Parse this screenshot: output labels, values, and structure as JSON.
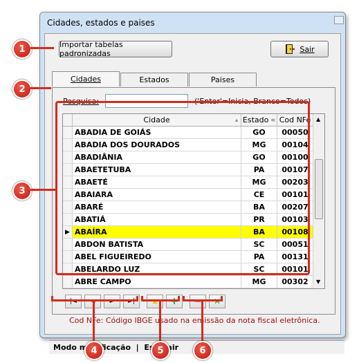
{
  "window": {
    "title": "Cidades, estados e paises"
  },
  "toolbar": {
    "import_label": "Importar tabelas padronizadas",
    "exit_label": "Sair"
  },
  "tabs": [
    {
      "label": "Cidades"
    },
    {
      "label": "Estados"
    },
    {
      "label": "Paises"
    }
  ],
  "search": {
    "label": "Pesquisa:",
    "value": "",
    "hint": "('Enter'=Inicia, Branco=Todos)"
  },
  "grid": {
    "columns": [
      "Cidade",
      "Estado",
      "Cod NFe"
    ],
    "rows": [
      {
        "cidade": "ABADIA DE GOIÁS",
        "estado": "GO",
        "cod": "00050"
      },
      {
        "cidade": "ABADIA DOS DOURADOS",
        "estado": "MG",
        "cod": "00104"
      },
      {
        "cidade": "ABADIÂNIA",
        "estado": "GO",
        "cod": "00100"
      },
      {
        "cidade": "ABAETETUBA",
        "estado": "PA",
        "cod": "00107"
      },
      {
        "cidade": "ABAETÉ",
        "estado": "MG",
        "cod": "00203"
      },
      {
        "cidade": "ABAIARA",
        "estado": "CE",
        "cod": "00101"
      },
      {
        "cidade": "ABARÉ",
        "estado": "BA",
        "cod": "00207"
      },
      {
        "cidade": "ABATIÁ",
        "estado": "PR",
        "cod": "00103"
      },
      {
        "cidade": "ABAÍRA",
        "estado": "BA",
        "cod": "00108"
      },
      {
        "cidade": "ABDON BATISTA",
        "estado": "SC",
        "cod": "00051"
      },
      {
        "cidade": "ABEL FIGUEIREDO",
        "estado": "PA",
        "cod": "00131"
      },
      {
        "cidade": "ABELARDO LUZ",
        "estado": "SC",
        "cod": "00101"
      },
      {
        "cidade": "ABRE CAMPO",
        "estado": "MG",
        "cod": "00302"
      }
    ],
    "selected_index": 8
  },
  "nav": {
    "first": "|◄",
    "prev": "◄",
    "next": "►",
    "last": "►|",
    "up": "▲",
    "add": "+",
    "remove": "−",
    "cancel": "✕"
  },
  "note": "Cod NFe: Código IBGE usado na emissão da nota fiscal eletrônica.",
  "statusbar": {
    "text": "Modo modificação  |  Esc-Sair"
  },
  "callouts": [
    "1",
    "2",
    "3",
    "4",
    "5",
    "6"
  ],
  "colors": {
    "callout": "#d42a1c",
    "selected_row": "#ffff00",
    "note": "#a01010"
  }
}
